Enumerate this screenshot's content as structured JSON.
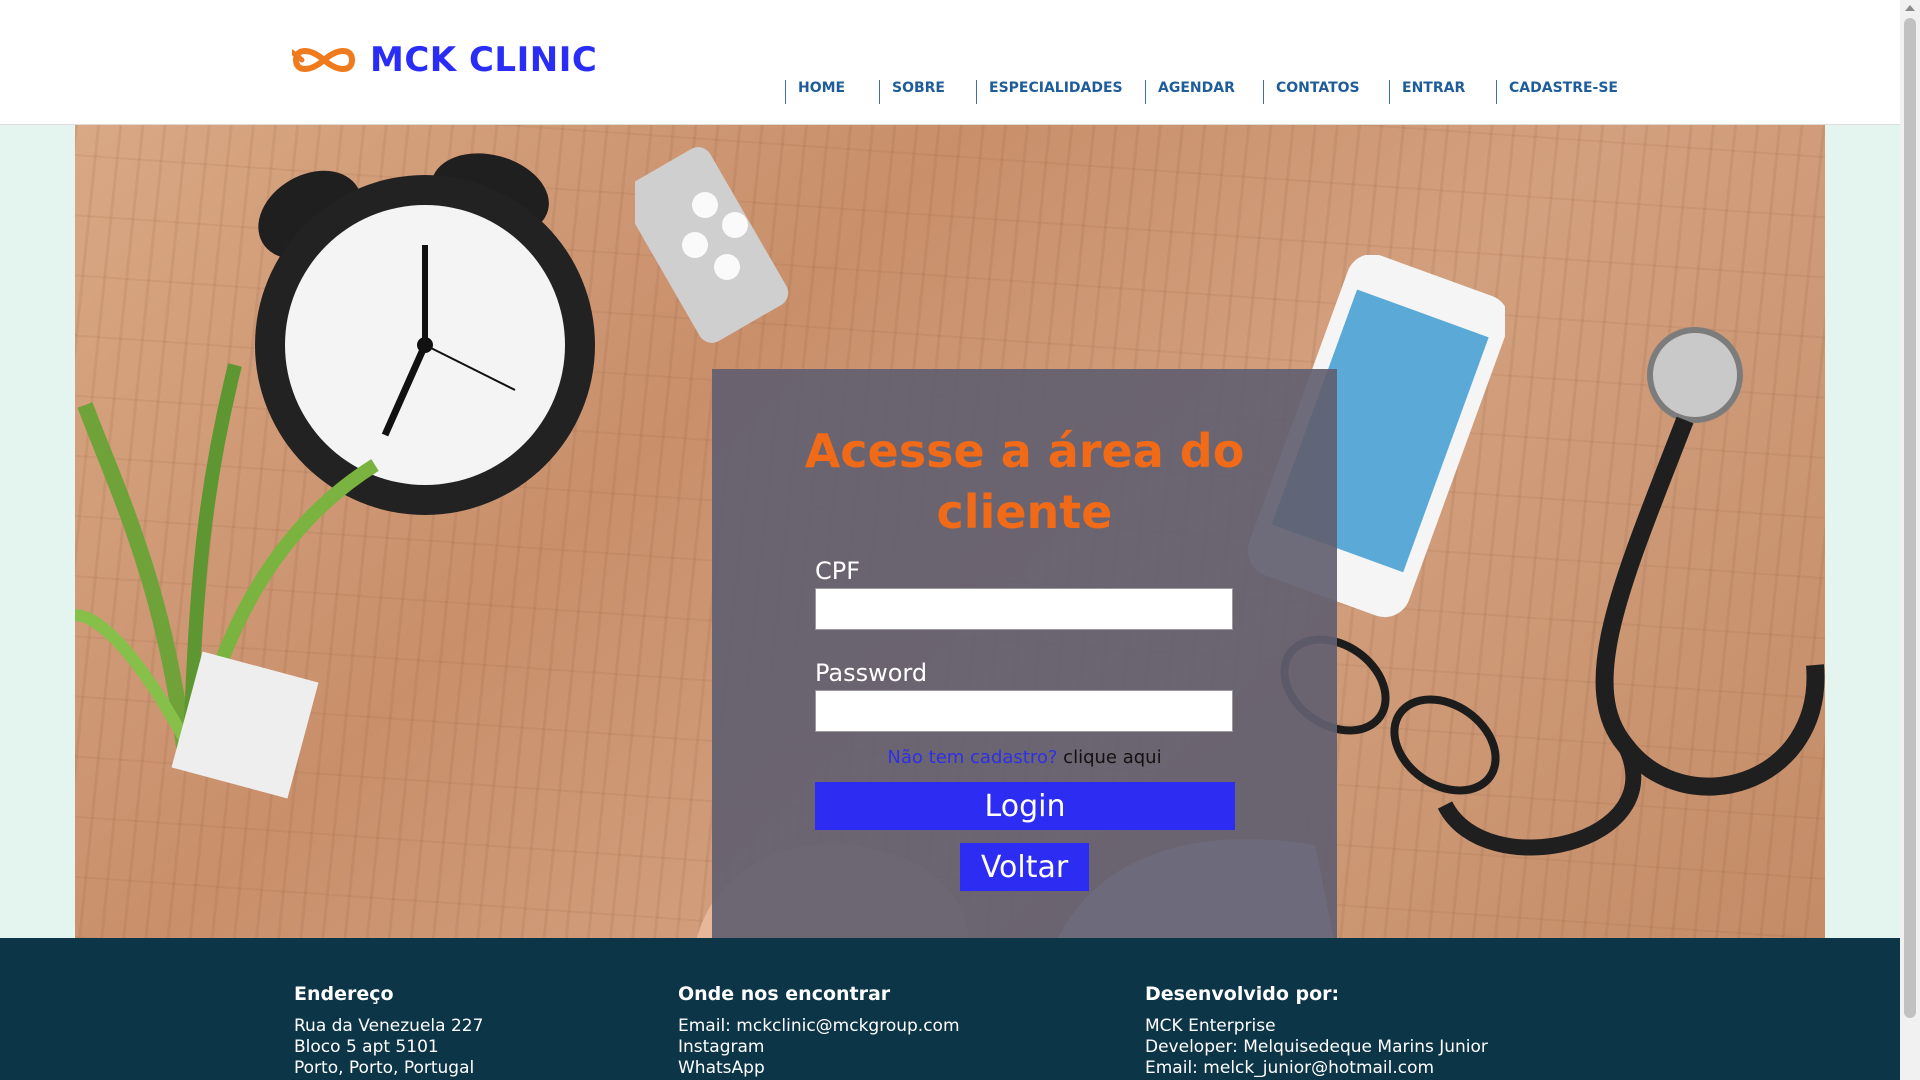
{
  "brand": {
    "name": "MCK CLINIC",
    "color": "#2a2df5",
    "icon_color": "#f07a1e",
    "icon": "infinity-logo-icon"
  },
  "nav": {
    "items": [
      {
        "label": "HOME"
      },
      {
        "label": "SOBRE"
      },
      {
        "label": "ESPECIALIDADES"
      },
      {
        "label": "AGENDAR"
      },
      {
        "label": "CONTATOS"
      },
      {
        "label": "ENTRAR"
      },
      {
        "label": "CADASTRE-SE"
      }
    ]
  },
  "login": {
    "title": "Acesse a área do cliente",
    "title_color": "#f06a18",
    "cpf_label": "CPF",
    "cpf_value": "",
    "password_label": "Password",
    "password_value": "",
    "signup_link": "Não tem cadastro?",
    "signup_suffix": "clique aqui",
    "login_button": "Login",
    "back_button": "Voltar",
    "button_color": "#2c2cf3"
  },
  "footer": {
    "address": {
      "heading": "Endereço",
      "lines": [
        "Rua da Venezuela 227",
        "Bloco 5 apt 5101",
        "Porto, Porto, Portugal"
      ]
    },
    "contact": {
      "heading": "Onde nos encontrar",
      "lines": [
        "Email: mckclinic@mckgroup.com",
        "Instagram",
        "WhatsApp"
      ]
    },
    "developer": {
      "heading": "Desenvolvido por:",
      "lines": [
        "MCK Enterprise",
        "Developer: Melquisedeque Marins Junior",
        "Email: melck_junior@hotmail.com"
      ]
    },
    "background_color": "#0d3548"
  }
}
